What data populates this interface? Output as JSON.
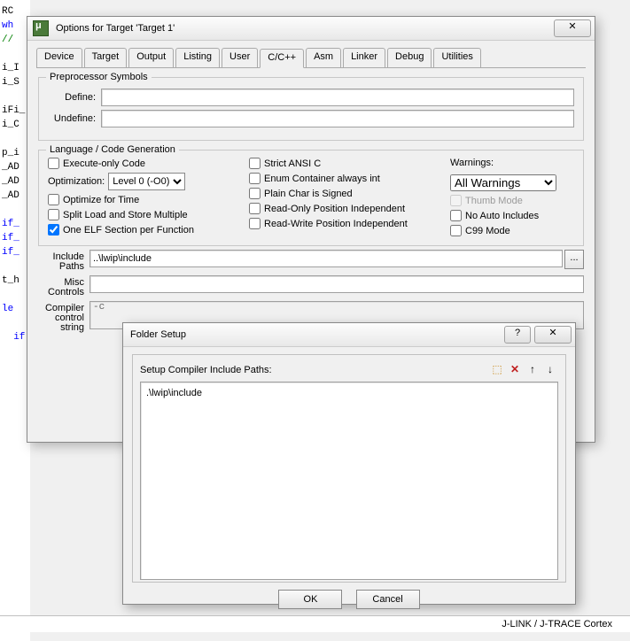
{
  "bg_code": {
    "lines": [
      "RC",
      "wh",
      "//",
      "",
      "i_I",
      "i_S",
      "",
      "iFi_",
      "i_C",
      "",
      "p_i",
      "_AD",
      "_AD",
      "_AD",
      "",
      "if_",
      "if_",
      "if_",
      "",
      "t_h",
      "",
      "le",
      "",
      "  if"
    ]
  },
  "dialog1": {
    "title": "Options for Target 'Target 1'",
    "tabs": [
      "Device",
      "Target",
      "Output",
      "Listing",
      "User",
      "C/C++",
      "Asm",
      "Linker",
      "Debug",
      "Utilities"
    ],
    "active_tab": "C/C++",
    "preproc": {
      "legend": "Preprocessor Symbols",
      "define_label": "Define:",
      "define_value": "",
      "undefine_label": "Undefine:",
      "undefine_value": ""
    },
    "lang": {
      "legend": "Language / Code Generation",
      "exec_only": "Execute-only Code",
      "optimization_label": "Optimization:",
      "optimization_value": "Level 0 (-O0)",
      "opt_time": "Optimize for Time",
      "split_load": "Split Load and Store Multiple",
      "one_elf": "One ELF Section per Function",
      "strict_ansi": "Strict ANSI C",
      "enum_int": "Enum Container always int",
      "plain_char": "Plain Char is Signed",
      "ro_pi": "Read-Only Position Independent",
      "rw_pi": "Read-Write Position Independent",
      "warnings_label": "Warnings:",
      "warnings_value": "All Warnings",
      "thumb": "Thumb Mode",
      "no_auto": "No Auto Includes",
      "c99": "C99 Mode"
    },
    "include_label": "Include\nPaths",
    "include_value": "..\\lwip\\include",
    "misc_label": "Misc\nControls",
    "misc_value": "",
    "compiler_label": "Compiler\ncontrol\nstring",
    "compiler_value": "-c",
    "browse": "..."
  },
  "dialog2": {
    "title": "Folder Setup",
    "help": "?",
    "list_label": "Setup Compiler Include Paths:",
    "icons": {
      "new": "⬚",
      "del": "✕",
      "up": "↑",
      "down": "↓"
    },
    "list_items": [
      ".\\lwip\\include"
    ],
    "ok": "OK",
    "cancel": "Cancel"
  },
  "status_text": "J-LINK / J-TRACE Cortex"
}
